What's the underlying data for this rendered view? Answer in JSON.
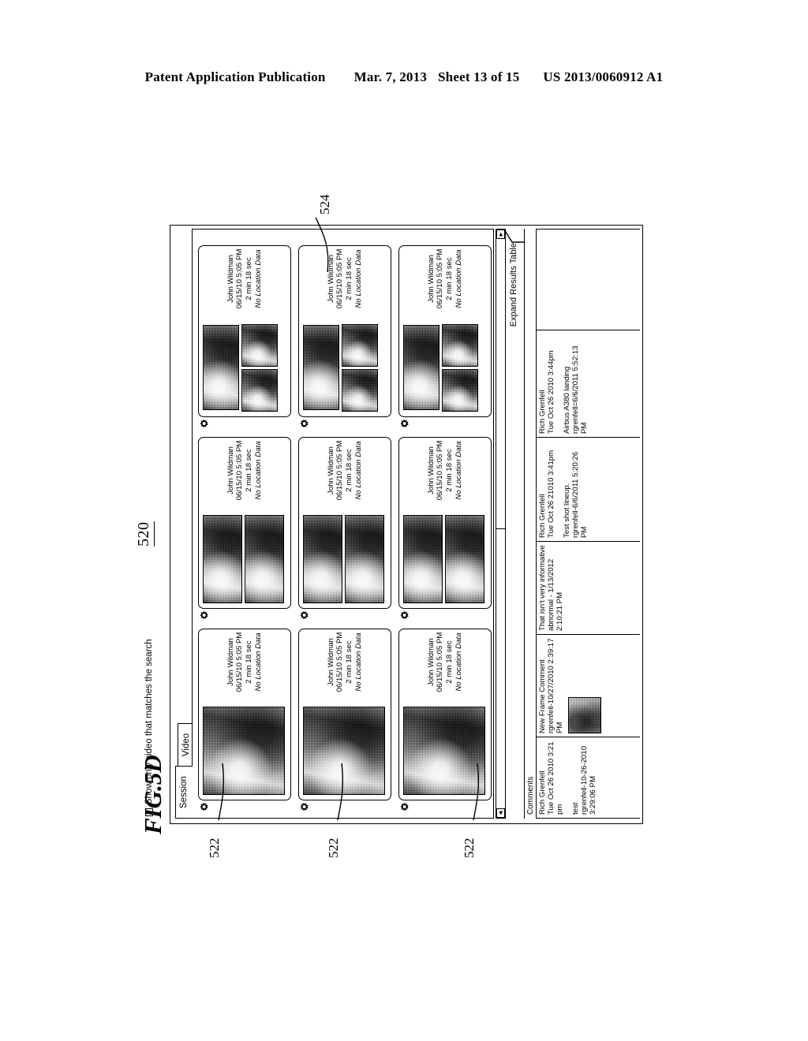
{
  "patent_header": {
    "publication": "Patent Application Publication",
    "date": "Mar. 7, 2013",
    "sheet": "Sheet 13 of 15",
    "number": "US 2013/0060912 A1"
  },
  "figure": {
    "label": "FIG.5D",
    "reference_numerals": {
      "screen": "520",
      "video_card": "522",
      "comments_table": "524"
    }
  },
  "ui": {
    "filter_checkbox": {
      "label": "Show only video that matches the search",
      "checked": true,
      "glyph": "✓"
    },
    "tabs": [
      {
        "label": "Session",
        "active": true
      },
      {
        "label": "Video",
        "active": false
      }
    ],
    "expand_results_table": "Expand Results Table",
    "scrollbar": {
      "left_arrow": "◄",
      "right_arrow": "►"
    },
    "video_cards": [
      {
        "owner": "John Wildman",
        "timestamp": "06/15/10 5:05 PM",
        "duration": "2 min 18 sec",
        "location": "No Location Data",
        "thumb_layout": "single-large"
      },
      {
        "owner": "John Wildman",
        "timestamp": "06/15/10 5:05 PM",
        "duration": "2 min 18 sec",
        "location": "No Location Data",
        "thumb_layout": "two-stacked"
      },
      {
        "owner": "John Wildman",
        "timestamp": "06/15/10 5:05 PM",
        "duration": "2 min 18 sec",
        "location": "No Location Data",
        "thumb_layout": "one-over-two"
      },
      {
        "owner": "John Wildman",
        "timestamp": "06/15/10 5:05 PM",
        "duration": "2 min 18 sec",
        "location": "No Location Data",
        "thumb_layout": "single-large"
      },
      {
        "owner": "John Wildman",
        "timestamp": "06/15/10 5:05 PM",
        "duration": "2 min 18 sec",
        "location": "No Location Data",
        "thumb_layout": "two-stacked"
      },
      {
        "owner": "John Wildman",
        "timestamp": "06/15/10 5:05 PM",
        "duration": "2 min 18 sec",
        "location": "No Location Data",
        "thumb_layout": "one-over-two"
      },
      {
        "owner": "John Wildman",
        "timestamp": "06/15/10 5:05 PM",
        "duration": "2 min 18 sec",
        "location": "No Location Data",
        "thumb_layout": "single-large"
      },
      {
        "owner": "John Wildman",
        "timestamp": "06/15/10 5:05 PM",
        "duration": "2 min 18 sec",
        "location": "No Location Data",
        "thumb_layout": "two-stacked"
      },
      {
        "owner": "John Wildman",
        "timestamp": "06/15/10 5:05 PM",
        "duration": "2 min 18 sec",
        "location": "No Location Data",
        "thumb_layout": "one-over-two"
      }
    ],
    "comments_table": {
      "header": "Comments",
      "columns": [
        {
          "author": "Rich Grenfell",
          "author_time": "Tue Oct 26 2010 3:21 pm",
          "body_title": "test",
          "body_meta": "rgrenfell-10-26-2010 3:29:06 PM",
          "has_thumbnail": false
        },
        {
          "author": "",
          "author_time": "",
          "body_title": "New Frame Comment",
          "body_meta": "rgrenfell-10/27/2010 2:39:17 PM",
          "has_thumbnail": true
        },
        {
          "author": "",
          "author_time": "",
          "body_title": "That isn't very informative",
          "body_meta": "abnormal - 1/13/2012 2:10:21 PM",
          "has_thumbnail": false
        },
        {
          "author": "Rich Grenfell",
          "author_time": "Tue Oct 26 21010 3:41pm",
          "body_title": "Test shot lineup.",
          "body_meta": "rgrenfell-6/6/2011 5:20:26 PM",
          "has_thumbnail": false
        },
        {
          "author": "Rich Grenfell",
          "author_time": "Tue Oct 26 2010 3:44pm",
          "body_title": "Airbus A380 landing",
          "body_meta": "rgrenfell=6/6/2011 5:52:13 PM",
          "has_thumbnail": false
        },
        {
          "author": "",
          "author_time": "",
          "body_title": "",
          "body_meta": "",
          "has_thumbnail": false
        }
      ]
    }
  }
}
